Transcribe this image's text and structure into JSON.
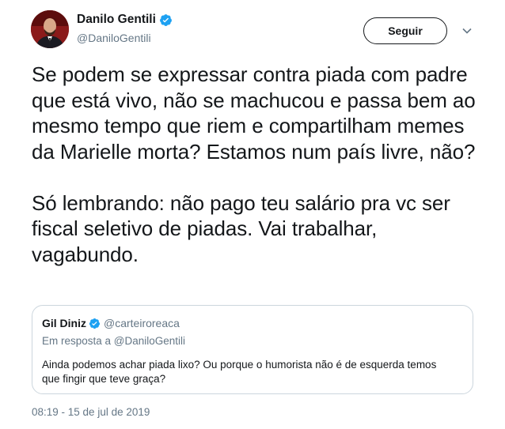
{
  "author": {
    "display_name": "Danilo Gentili",
    "handle": "@DaniloGentili",
    "avatar_icon": "profile-photo",
    "verified_icon": "verified-badge-icon"
  },
  "actions": {
    "follow_label": "Seguir",
    "more_icon": "chevron-down-icon"
  },
  "tweet": {
    "paragraph_1": "Se podem se expressar contra piada com padre que está vivo, não se machucou e passa bem ao mesmo tempo que riem e compartilham memes da Marielle morta? Estamos num país livre, não?",
    "paragraph_2": "Só lembrando: não pago teu salário pra vc ser fiscal seletivo de piadas. Vai trabalhar, vagabundo.",
    "timestamp": "08:19 - 15 de jul de 2019"
  },
  "quoted_tweet": {
    "display_name": "Gil Diniz",
    "handle": "@carteiroreaca",
    "reply_context": "Em resposta a @DaniloGentili",
    "text": "Ainda podemos achar piada lixo? Ou porque o humorista não é de esquerda temos que fingir que teve graça?"
  },
  "colors": {
    "verified_blue": "#1da1f2",
    "secondary_text": "#657786",
    "border": "#ccd6dd"
  }
}
